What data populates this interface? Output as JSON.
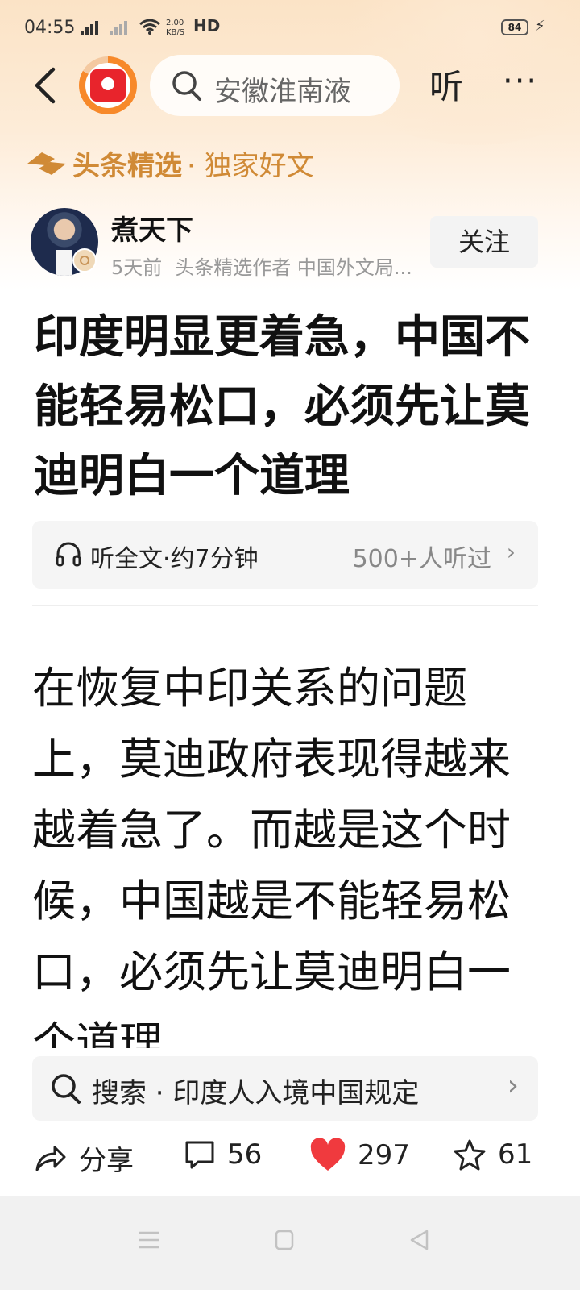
{
  "status_bar": {
    "time": "04:55",
    "network_speed_value": "2.00",
    "network_speed_unit": "KB/S",
    "hd_label": "HD",
    "battery": "84"
  },
  "nav": {
    "search_placeholder": "安徽淮南液",
    "listen_label": "听",
    "more_label": "···"
  },
  "brand": {
    "name": "头条精选",
    "subtitle": "· 独家好文"
  },
  "author": {
    "name": "煮天下",
    "time": "5天前",
    "label": "头条精选作者 中国外文局...",
    "follow_label": "关注"
  },
  "article": {
    "title": "印度明显更着急，中国不能轻易松口，必须先让莫迪明白一个道理",
    "listen_text": "听全文·约7分钟",
    "listen_count": "500+人听过",
    "body": "在恢复中印关系的问题上，莫迪政府表现得越来越着急了。而越是这个时候，中国越是不能轻易松口，必须先让莫迪明白一个道理"
  },
  "related_search": {
    "text": "搜索 · 印度人入境中国规定"
  },
  "actions": {
    "share_label": "分享",
    "comments": "56",
    "likes": "297",
    "favorites": "61"
  },
  "colors": {
    "brand": "#d08a36",
    "like": "#f03a3e",
    "accent_orange": "#f7892a"
  }
}
